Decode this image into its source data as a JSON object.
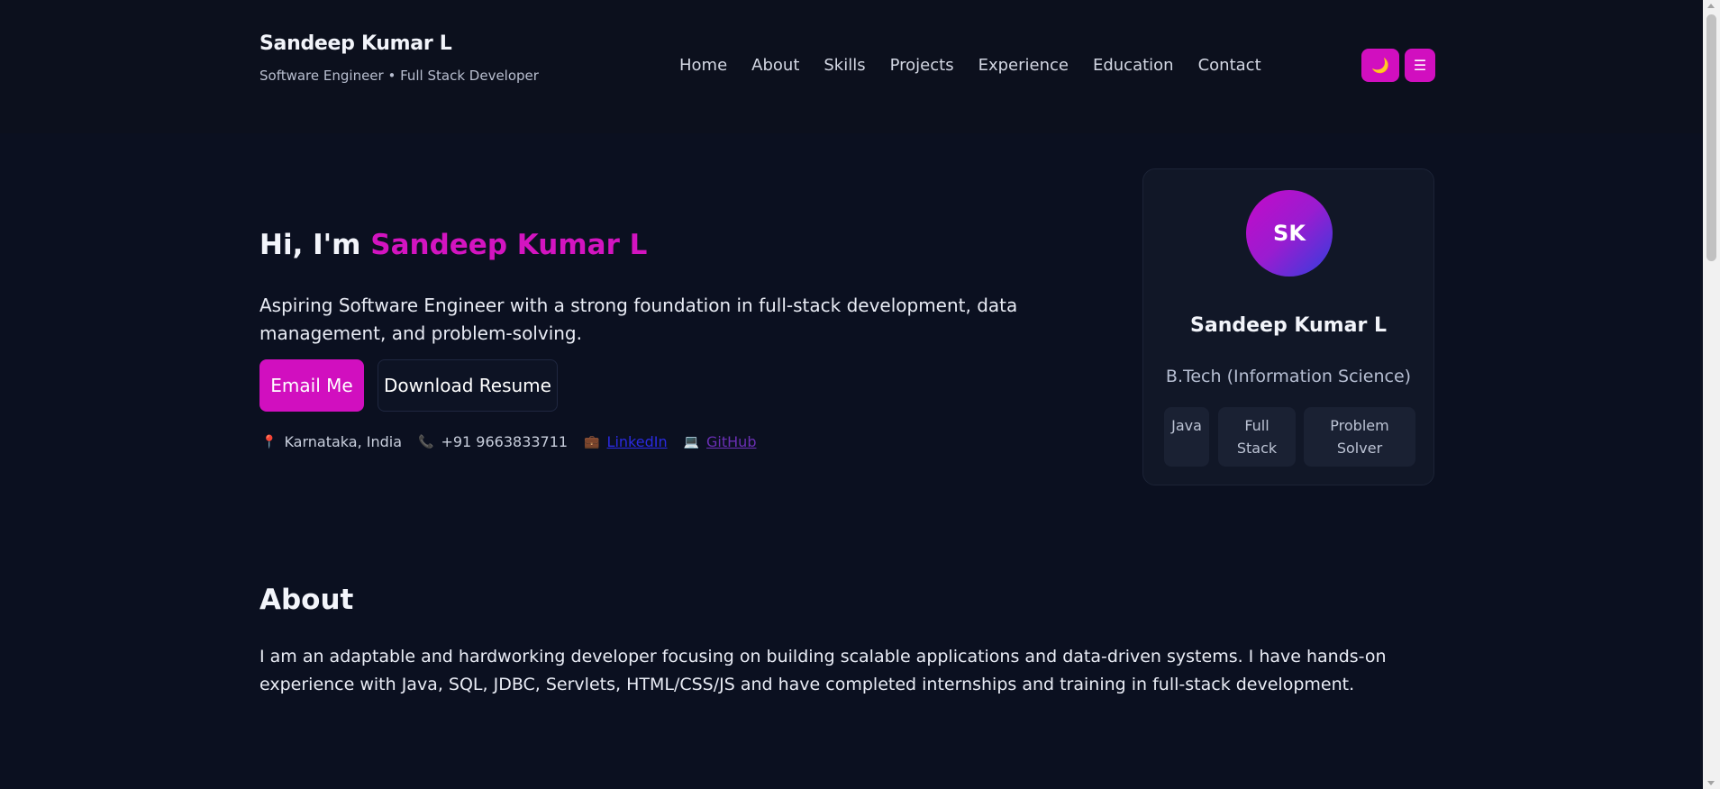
{
  "header": {
    "name": "Sandeep Kumar L",
    "subtitle": "Software Engineer • Full Stack Developer",
    "nav": [
      "Home",
      "About",
      "Skills",
      "Projects",
      "Experience",
      "Education",
      "Contact"
    ],
    "theme_toggle_glyph": "🌙",
    "menu_glyph": "☰"
  },
  "hero": {
    "greeting": "Hi, I'm ",
    "name": "Sandeep Kumar L",
    "intro": "Aspiring Software Engineer with a strong foundation in full-stack development, data management, and problem-solving.",
    "email_button": "Email Me",
    "resume_button": "Download Resume",
    "location_icon": "📍",
    "location": "Karnataka, India",
    "phone_icon": "📞",
    "phone": "+91 9663833711",
    "linkedin_icon": "💼",
    "linkedin": "LinkedIn",
    "github_icon": "💻",
    "github": "GitHub"
  },
  "profile_card": {
    "initials": "SK",
    "name": "Sandeep Kumar L",
    "degree": "B.Tech (Information Science)",
    "chips": [
      "Java",
      "Full Stack",
      "Problem Solver"
    ]
  },
  "about": {
    "title": "About",
    "text": "I am an adaptable and hardworking developer focusing on building scalable applications and data-driven systems. I have hands-on experience with Java, SQL, JDBC, Servlets, HTML/CSS/JS and have completed internships and training in full-stack development."
  },
  "colors": {
    "accent": "#d10fbf",
    "background": "#0b1020",
    "card": "#111727"
  }
}
